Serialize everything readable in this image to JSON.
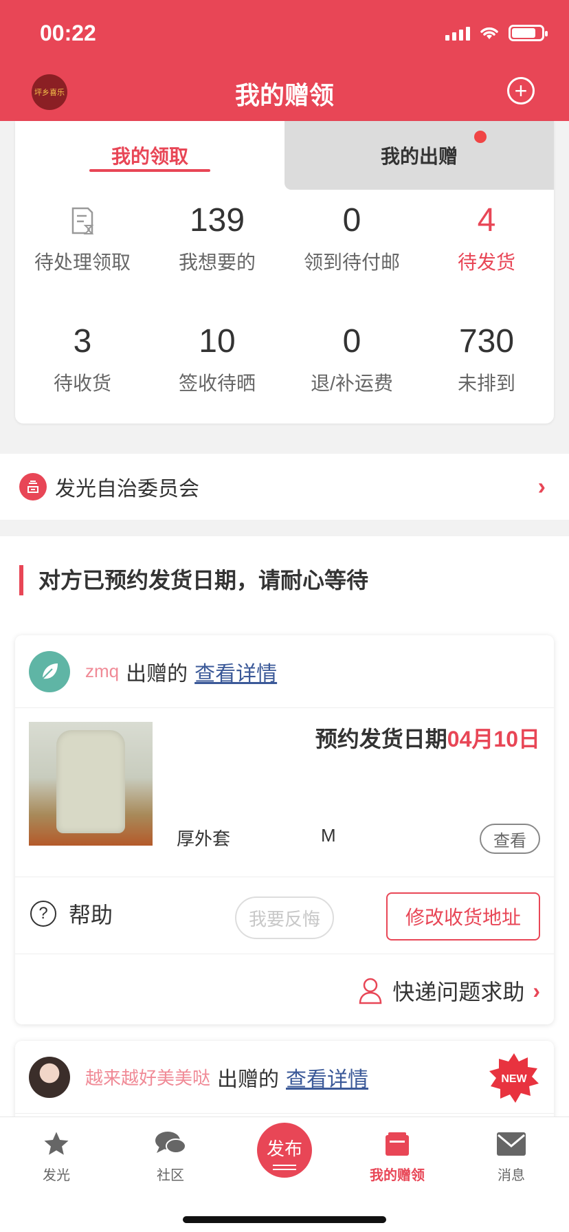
{
  "status": {
    "time": "00:22"
  },
  "header": {
    "title": "我的赠领",
    "avatar_text": "坪乡喜乐"
  },
  "tabs": [
    {
      "label": "我的领取",
      "active": true
    },
    {
      "label": "我的出赠",
      "active": false,
      "has_dot": true
    }
  ],
  "stats": [
    {
      "value": "",
      "label": "待处理领取",
      "icon": "document-icon"
    },
    {
      "value": "139",
      "label": "我想要的"
    },
    {
      "value": "0",
      "label": "领到待付邮"
    },
    {
      "value": "4",
      "label": "待发货",
      "highlight": true
    },
    {
      "value": "3",
      "label": "待收货"
    },
    {
      "value": "10",
      "label": "签收待晒"
    },
    {
      "value": "0",
      "label": "退/补运费"
    },
    {
      "value": "730",
      "label": "未排到"
    }
  ],
  "committee": {
    "label": "发光自治委员会"
  },
  "section": {
    "title": "对方已预约发货日期，请耐心等待"
  },
  "order1": {
    "giver": "zmq",
    "gave_text": "出赠的",
    "detail_link": "查看详情",
    "ship_label": "预约发货日期",
    "ship_date": "04月10日",
    "item_name": "厚外套",
    "item_size": "M",
    "view_btn": "查看",
    "help_label": "帮助",
    "regret_btn": "我要反悔",
    "address_btn": "修改收货地址",
    "express_help": "快递问题求助"
  },
  "order2": {
    "giver": "越来越好美美哒",
    "gave_text": "出赠的",
    "detail_link": "查看详情",
    "badge": "NEW"
  },
  "tabbar": {
    "items": [
      {
        "label": "发光",
        "icon": "star-icon"
      },
      {
        "label": "社区",
        "icon": "chat-icon"
      },
      {
        "label": "发布",
        "icon": "publish-icon"
      },
      {
        "label": "我的赠领",
        "icon": "box-icon",
        "active": true
      },
      {
        "label": "消息",
        "icon": "mail-icon"
      }
    ]
  },
  "colors": {
    "brand": "#e84656",
    "link": "#3b5998"
  }
}
